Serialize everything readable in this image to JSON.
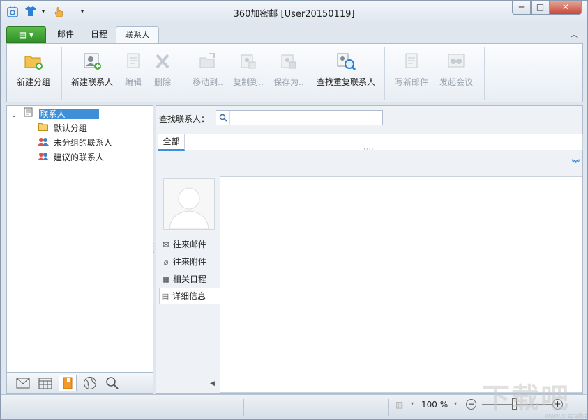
{
  "window": {
    "title": "360加密邮 [User20150119]",
    "buttons": {
      "minimize": "─",
      "maximize": "□",
      "close": "✕"
    }
  },
  "quick_access": {
    "icons": [
      "app-logo-icon",
      "shirt-icon",
      "hand-icon",
      "more-icon"
    ]
  },
  "tabs": {
    "menu": "▤ ▾",
    "items": [
      {
        "label": "邮件"
      },
      {
        "label": "日程"
      },
      {
        "label": "联系人"
      }
    ],
    "collapse": "︿"
  },
  "ribbon": {
    "new_group": "新建分组",
    "new_contact": "新建联系人",
    "edit": "编辑",
    "delete": "删除",
    "move_to": "移动到..",
    "copy_to": "复制到..",
    "save_as": "保存为..",
    "find_duplicates": "查找重复联系人",
    "write_mail": "写新邮件",
    "start_meeting": "发起会议"
  },
  "tree": {
    "root": "联系人",
    "items": [
      {
        "label": "默认分组"
      },
      {
        "label": "未分组的联系人"
      },
      {
        "label": "建议的联系人"
      }
    ]
  },
  "search": {
    "label": "查找联系人：",
    "placeholder": ""
  },
  "filter": {
    "all": "全部"
  },
  "detail_nav": {
    "items": [
      {
        "label": "往来邮件",
        "icon": "✉"
      },
      {
        "label": "往来附件",
        "icon": "⌀"
      },
      {
        "label": "相关日程",
        "icon": "▦"
      },
      {
        "label": "详细信息",
        "icon": "▤"
      }
    ]
  },
  "status": {
    "zoom": "100 %"
  },
  "watermark": {
    "text": "下载吧",
    "url": "www.xiazaiba.com"
  },
  "colors": {
    "accent": "#3f8fd8",
    "menu_green": "#3a9a2f",
    "close_red": "#c8493a"
  }
}
